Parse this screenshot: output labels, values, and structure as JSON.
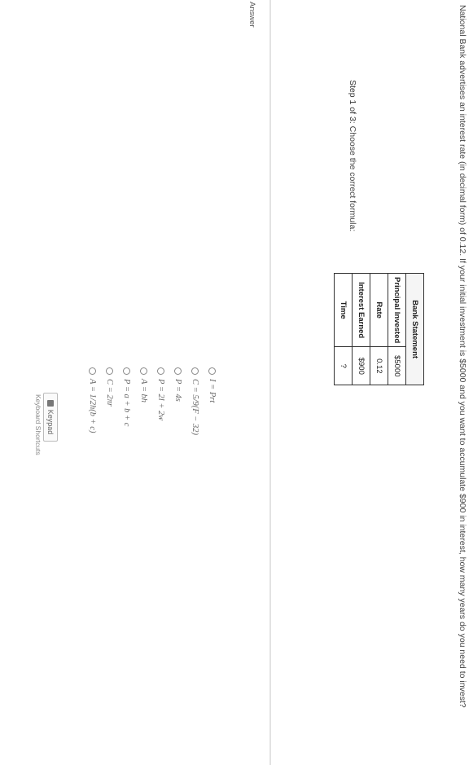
{
  "question": {
    "text": "National Bank advertises an interest rate (in decimal form) of 0.12. If your initial investment is $5000 and you want to accumulate $900 in interest, how many years do you need to invest?"
  },
  "step": {
    "prefix": "Step 1 of 3:",
    "text": "Choose the correct formula:"
  },
  "bank_table": {
    "title": "Bank Statement",
    "rows": [
      {
        "label": "Principal Invested",
        "value": "$5000"
      },
      {
        "label": "Rate",
        "value": "0.12"
      },
      {
        "label": "Interest Earned",
        "value": "$900"
      },
      {
        "label": "Time",
        "value": "?"
      }
    ]
  },
  "answer": {
    "label": "Answer",
    "options": [
      "I = Prt",
      "C = 5/9(F − 32)",
      "P = 4s",
      "P = 2l + 2w",
      "A = bh",
      "P = a + b + c",
      "C = 2πr",
      "A = 1/2h(b + c)"
    ]
  },
  "controls": {
    "keypad_label": "Keypad",
    "shortcuts_label": "Keyboard Shortcuts"
  },
  "colors": {
    "divider": "#e3e3e3",
    "text": "#333333"
  }
}
